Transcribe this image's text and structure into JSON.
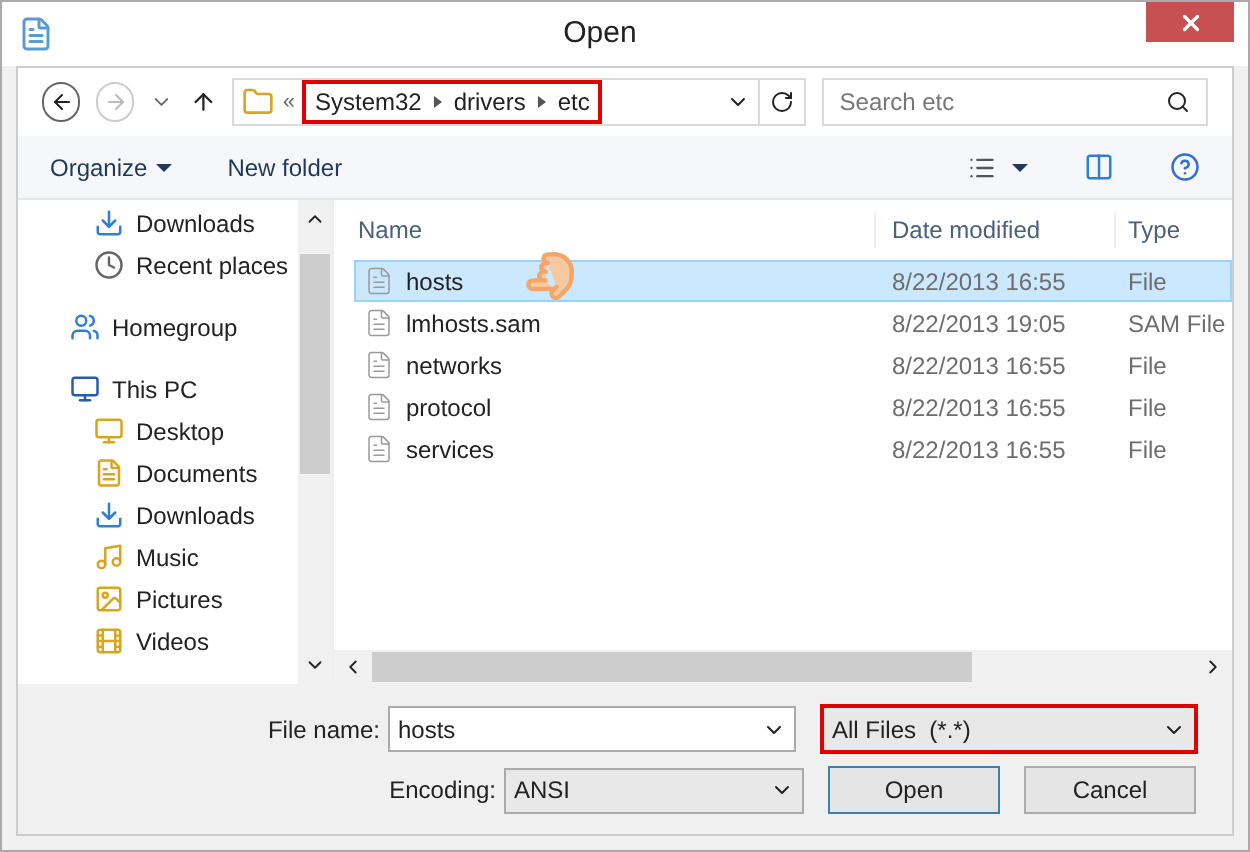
{
  "window": {
    "title": "Open"
  },
  "address": {
    "overflow": "«",
    "segments": [
      "System32",
      "drivers",
      "etc"
    ],
    "highlighted": true
  },
  "search": {
    "placeholder": "Search etc"
  },
  "toolbar": {
    "organize": "Organize",
    "new_folder": "New folder"
  },
  "sidebar": {
    "items": [
      {
        "label": "Downloads"
      },
      {
        "label": "Recent places"
      },
      {
        "label": "Homegroup"
      },
      {
        "label": "This PC",
        "children": [
          {
            "label": "Desktop"
          },
          {
            "label": "Documents"
          },
          {
            "label": "Downloads"
          },
          {
            "label": "Music"
          },
          {
            "label": "Pictures"
          },
          {
            "label": "Videos"
          }
        ]
      }
    ]
  },
  "table": {
    "columns": [
      "Name",
      "Date modified",
      "Type"
    ],
    "rows": [
      {
        "name": "hosts",
        "date": "8/22/2013 16:55",
        "type": "File",
        "selected": true
      },
      {
        "name": "lmhosts.sam",
        "date": "8/22/2013 19:05",
        "type": "SAM File",
        "selected": false
      },
      {
        "name": "networks",
        "date": "8/22/2013 16:55",
        "type": "File",
        "selected": false
      },
      {
        "name": "protocol",
        "date": "8/22/2013 16:55",
        "type": "File",
        "selected": false
      },
      {
        "name": "services",
        "date": "8/22/2013 16:55",
        "type": "File",
        "selected": false
      }
    ]
  },
  "bottom": {
    "file_name_label": "File name:",
    "file_name": "hosts",
    "filter": "All Files  (*.*)",
    "filter_highlighted": true,
    "encoding_label": "Encoding:",
    "encoding": "ANSI",
    "buttons": [
      "Open",
      "Cancel"
    ]
  }
}
